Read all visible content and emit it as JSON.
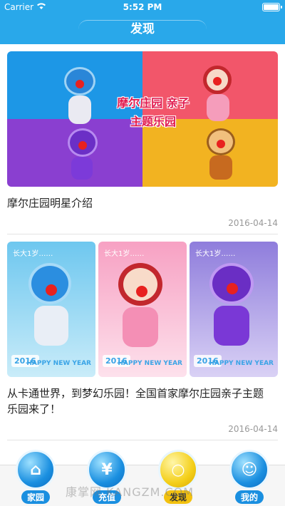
{
  "status": {
    "carrier": "Carrier",
    "time": "5:52 PM"
  },
  "nav": {
    "title": "发现"
  },
  "articles": [
    {
      "title": "摩尔庄园明星介绍",
      "date": "2016-04-14",
      "banner_text": "摩尔庄园 亲子主题乐园"
    },
    {
      "title": "从卡通世界，到梦幻乐园！全国首家摩尔庄园亲子主题乐园来了！",
      "date": "2016-04-14",
      "posters": [
        {
          "tag": "长大1岁……",
          "year": "2016",
          "caption": "HAPPY NEW YEAR"
        },
        {
          "tag": "长大1岁……",
          "year": "2016",
          "caption": "HAPPY NEW YEAR"
        },
        {
          "tag": "长大1岁……",
          "year": "2016",
          "caption": "HAPPY NEW YEAR"
        }
      ]
    }
  ],
  "tabs": [
    {
      "label": "家园",
      "icon": "house-icon",
      "glyph": "⌂"
    },
    {
      "label": "充值",
      "icon": "yen-icon",
      "glyph": "¥"
    },
    {
      "label": "发现",
      "icon": "discover-icon",
      "glyph": "○"
    },
    {
      "label": "我的",
      "icon": "profile-icon",
      "glyph": "☺"
    }
  ],
  "watermark": "康掌网 KANGZM.COM",
  "colors": {
    "nav": "#29a8ea",
    "tab_active": "#f2c10f",
    "tab": "#1a8fe0"
  }
}
